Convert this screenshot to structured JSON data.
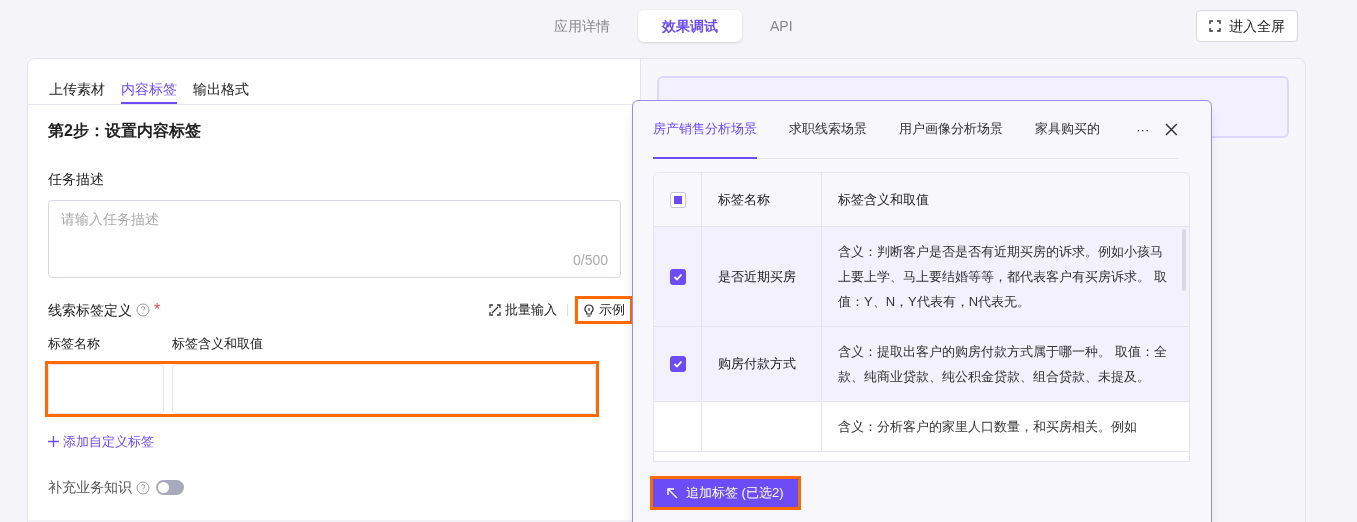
{
  "top_tabs": [
    {
      "label": "应用详情",
      "selected": false
    },
    {
      "label": "效果调试",
      "selected": true
    },
    {
      "label": "API",
      "selected": false
    }
  ],
  "fullscreen_button": {
    "label": "进入全屏"
  },
  "left_card": {
    "tabs": [
      {
        "label": "上传素材",
        "selected": false
      },
      {
        "label": "内容标签",
        "selected": true
      },
      {
        "label": "输出格式",
        "selected": false
      }
    ],
    "heading": "第2步：设置内容标签",
    "task_label": "任务描述",
    "task_placeholder": "请输入任务描述",
    "task_count": "0/500",
    "tag_def_label": "线索标签定义",
    "required_mark": "*",
    "batch_button": "批量输入",
    "example_button": {
      "label": "示例",
      "highlighted": true
    },
    "columns": [
      "标签名称",
      "标签含义和取值"
    ],
    "tag_inputs": {
      "highlighted": true
    },
    "add_link": "添加自定义标签",
    "knowledge_label": "补充业务知识",
    "knowledge_switch": {
      "on": false
    }
  },
  "notice": {
    "kind": "banner"
  },
  "popover": {
    "tabs": [
      {
        "label": "房产销售分析场景",
        "selected": true
      },
      {
        "label": "求职线索场景",
        "selected": false
      },
      {
        "label": "用户画像分析场景",
        "selected": false
      },
      {
        "label": "家具购买的",
        "selected": false
      }
    ],
    "more": "···",
    "columns": [
      "标签名称",
      "标签含义和取值"
    ],
    "header_checkbox": {
      "indeterminate": true
    },
    "rows": [
      {
        "checked": true,
        "name": "是否近期买房",
        "description": "含义：判断客户是否是否有近期买房的诉求。例如小孩马上要上学、马上要结婚等等，都代表客户有买房诉求。 取值：Y、N，Y代表有，N代表无。"
      },
      {
        "checked": true,
        "name": "购房付款方式",
        "description": "含义：提取出客户的购房付款方式属于哪一种。 取值：全款、纯商业贷款、纯公积金贷款、组合贷款、未提及。"
      },
      {
        "description": "含义：分析客户的家里人口数量，和买房相关。例如"
      }
    ],
    "add_button": {
      "label": "追加标签 (已选2)",
      "highlighted": true
    }
  }
}
